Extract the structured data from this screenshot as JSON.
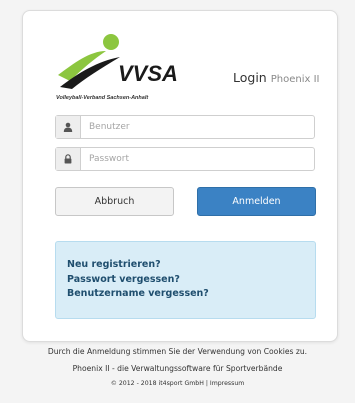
{
  "logo": {
    "wordmark": "VVSA",
    "subtitle": "Volleyball-Verband Sachsen-Anhalt",
    "colors": {
      "green": "#8cc63f",
      "dark": "#1a1a1a"
    }
  },
  "header": {
    "title": "Login",
    "subtitle": "Phoenix II"
  },
  "form": {
    "username": {
      "placeholder": "Benutzer",
      "value": "",
      "icon": "user-icon"
    },
    "password": {
      "placeholder": "Passwort",
      "value": "",
      "icon": "lock-icon"
    }
  },
  "buttons": {
    "cancel": "Abbruch",
    "login": "Anmelden"
  },
  "help_links": [
    "Neu registrieren?",
    "Passwort vergessen?",
    "Benutzername vergessen?"
  ],
  "footer": {
    "cookies": "Durch die Anmeldung stimmen Sie der Verwendung von Cookies zu.",
    "software": "Phoenix II - die Verwaltungssoftware für Sportverbände",
    "copyright": "© 2012 - 2018 it4sport GmbH |",
    "impressum": "Impressum"
  },
  "colors": {
    "primary_button": "#3b82c4",
    "help_background": "#d9edf7",
    "help_link": "#1f4e6e"
  }
}
